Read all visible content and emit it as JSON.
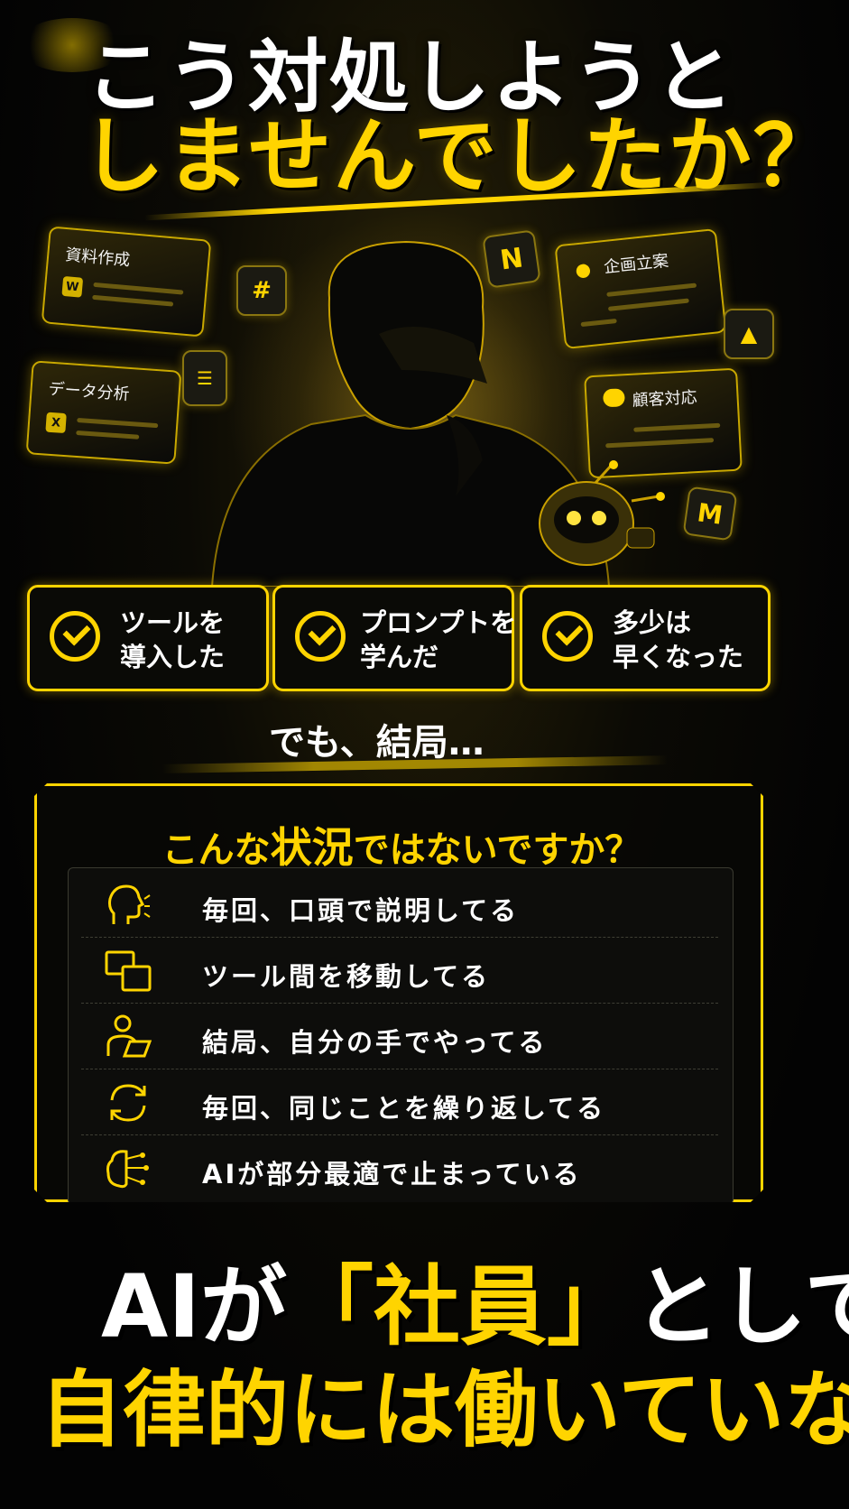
{
  "headline": {
    "line1": "こう対処しようと",
    "line2": "しませんでしたか？"
  },
  "floating_cards": [
    {
      "label": "資料作成",
      "icon": "word-icon",
      "icon_text": "W"
    },
    {
      "label": "データ分析",
      "icon": "excel-icon",
      "icon_text": "X"
    },
    {
      "label": "企画立案",
      "icon": "lightbulb-icon"
    },
    {
      "label": "顧客対応",
      "icon": "chat-bubble-icon"
    }
  ],
  "app_icons": [
    {
      "name": "slack-icon"
    },
    {
      "name": "notion-icon",
      "text": "N"
    },
    {
      "name": "google-docs-icon"
    },
    {
      "name": "google-drive-icon"
    },
    {
      "name": "gmail-icon",
      "text": "M"
    }
  ],
  "checks": [
    {
      "line1": "ツールを",
      "line2": "導入した"
    },
    {
      "line1": "プロンプトを",
      "line2": "学んだ"
    },
    {
      "line1": "多少は",
      "line2": "早くなった"
    }
  ],
  "transition_text": "でも、結局…",
  "situations": {
    "title_pre": "こんな",
    "title_big": "状況",
    "title_post": "ではないですか？",
    "items": [
      {
        "text": "毎回、口頭で説明してる",
        "icon": "speaking-head-icon"
      },
      {
        "text": "ツール間を移動してる",
        "icon": "switch-windows-icon"
      },
      {
        "text": "結局、自分の手でやってる",
        "icon": "person-laptop-icon"
      },
      {
        "text": "毎回、同じことを繰り返してる",
        "icon": "refresh-cycle-icon"
      },
      {
        "text": "AIが部分最適で止まっている",
        "icon": "ai-brain-icon"
      }
    ]
  },
  "conclusion": {
    "line1_pre": "AIが",
    "line1_quote": "「社員」",
    "line1_post": "として、",
    "line2": "自律的には働いていない。"
  },
  "colors": {
    "accent": "#ffd400",
    "background": "#050505",
    "text": "#ffffff"
  }
}
